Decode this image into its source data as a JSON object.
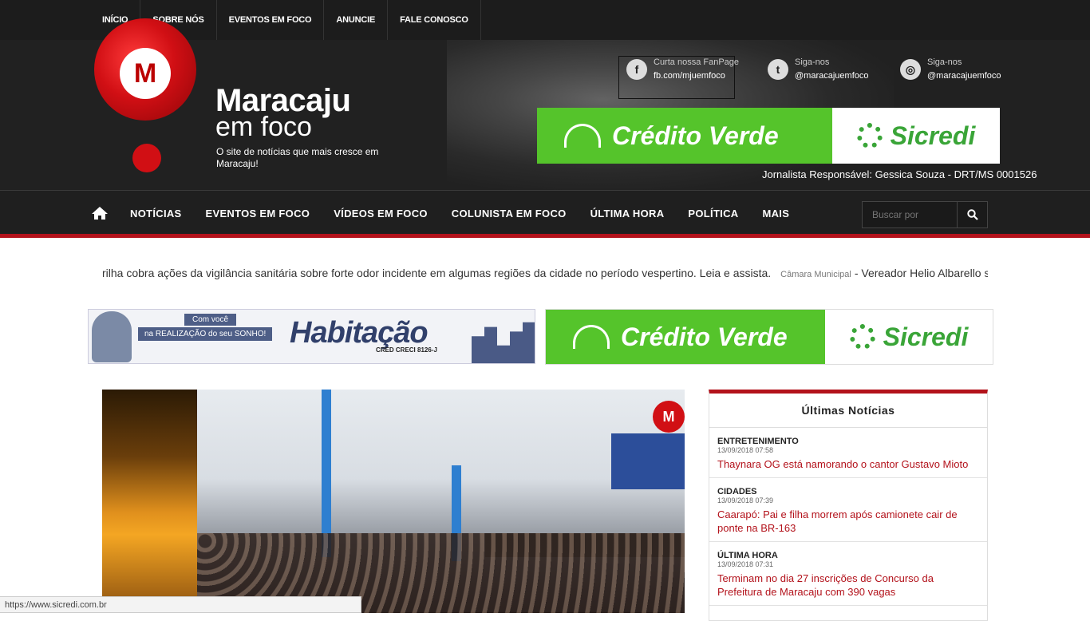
{
  "top_nav": [
    "INÍCIO",
    "SOBRE NÓS",
    "EVENTOS EM FOCO",
    "ANUNCIE",
    "FALE CONOSCO"
  ],
  "logo": {
    "letter": "M",
    "name1": "Maracaju",
    "name2": "em foco",
    "tagline": "O site de notícias que mais cresce em Maracaju!"
  },
  "social": {
    "facebook": {
      "label": "Curta nossa FanPage",
      "handle": "fb.com/mjuemfoco"
    },
    "twitter": {
      "label": "Siga-nos",
      "handle": "@maracajuemfoco"
    },
    "instagram": {
      "label": "Siga-nos",
      "handle": "@maracajuemfoco"
    }
  },
  "banner_top": {
    "left": "Crédito Verde",
    "right": "Sicredi"
  },
  "journalist": "Jornalista Responsável: Gessica Souza - DRT/MS 0001526",
  "main_nav": [
    "NOTÍCIAS",
    "EVENTOS EM FOCO",
    "VÍDEOS EM FOCO",
    "COLUNISTA EM FOCO",
    "ÚLTIMA HORA",
    "POLÍTICA",
    "MAIS"
  ],
  "search": {
    "placeholder": "Buscar por"
  },
  "ticker": {
    "text1": "rilha cobra ações da vigilância sanitária sobre forte odor incidente em algumas regiões da cidade no período vespertino. Leia e assista.",
    "category": "Câmara Municipal",
    "text2": "- Vereador Helio Albarello sc"
  },
  "ad_left": {
    "tag1": "Com você",
    "tag2": "na REALIZAÇÃO do seu SONHO!",
    "brand": "Habitação",
    "sub": "CRED  CRECI 8126-J"
  },
  "ad_right": {
    "left": "Crédito Verde",
    "right": "Sicredi"
  },
  "hero": {
    "watermark": "M"
  },
  "sidebar": {
    "title": "Últimas Notícias",
    "items": [
      {
        "category": "ENTRETENIMENTO",
        "date": "13/09/2018 07:58",
        "title": "Thaynara OG está namorando o cantor Gustavo Mioto"
      },
      {
        "category": "CIDADES",
        "date": "13/09/2018 07:39",
        "title": "Caarapó: Pai e filha morrem após camionete cair de ponte na BR-163"
      },
      {
        "category": "ÚLTIMA HORA",
        "date": "13/09/2018 07:31",
        "title": "Terminam no dia 27 inscrições de Concurso da Prefeitura de Maracaju com 390 vagas"
      }
    ]
  },
  "status_url": "https://www.sicredi.com.br"
}
